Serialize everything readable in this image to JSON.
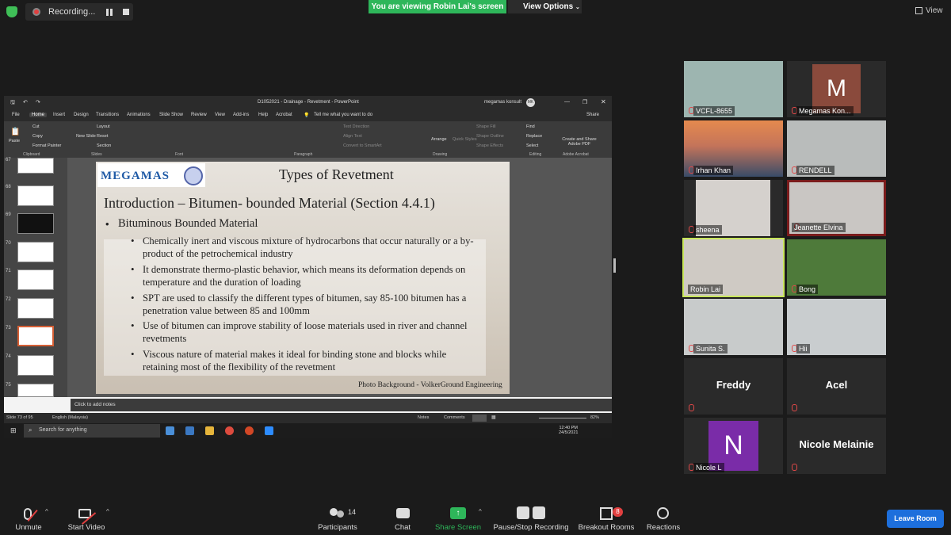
{
  "topbar": {
    "recording_label": "Recording...",
    "viewing_banner": "You are viewing Robin Lai's screen",
    "view_options": "View Options",
    "view_label": "View"
  },
  "ppt": {
    "window_title": "D1052021 - Drainage - Revetment - PowerPoint",
    "account": "megamas konsult",
    "account_initials": "MK",
    "share_label": "Share",
    "tabs": [
      "File",
      "Home",
      "Insert",
      "Design",
      "Transitions",
      "Animations",
      "Slide Show",
      "Review",
      "View",
      "Add-ins",
      "Help",
      "Acrobat"
    ],
    "tell_me": "Tell me what you want to do",
    "ribbon": {
      "paste": "Paste",
      "cut": "Cut",
      "copy": "Copy",
      "format_painter": "Format Painter",
      "new_slide": "New Slide",
      "layout": "Layout",
      "reset": "Reset",
      "section": "Section",
      "arrange": "Arrange",
      "quick_styles": "Quick Styles",
      "find": "Find",
      "replace": "Replace",
      "select": "Select",
      "create_pdf": "Create and Share Adobe PDF",
      "text_direction": "Text Direction",
      "align_text": "Align Text",
      "convert_smartart": "Convert to SmartArt",
      "shape_fill": "Shape Fill",
      "shape_outline": "Shape Outline",
      "shape_effects": "Shape Effects",
      "groups": [
        "Clipboard",
        "Slides",
        "Font",
        "Paragraph",
        "Drawing",
        "Editing",
        "Adobe Acrobat"
      ]
    },
    "thumbnails": [
      "67",
      "68",
      "69",
      "70",
      "71",
      "72",
      "73",
      "74",
      "75"
    ],
    "slide": {
      "logo": "MEGAMAS",
      "title": "Types of Revetment",
      "subtitle": "Introduction – Bitumen- bounded Material  (Section 4.4.1)",
      "bullet_main": "Bituminous Bounded Material",
      "bullets": [
        "Chemically inert and viscous mixture of hydrocarbons that occur naturally or a by-product of the petrochemical industry",
        "It demonstrate thermo-plastic behavior, which means its deformation depends on temperature and the duration of loading",
        "SPT are used to classify the different types of bitumen, say 85-100 bitumen has a penetration value between 85 and 100mm",
        "Use of bitumen can improve stability of loose materials used in river and channel revetments",
        "Viscous nature of material makes it ideal for binding stone and blocks while retaining most of the flexibility of the revetment"
      ],
      "credit": "Photo Background - VolkerGround Engineering"
    },
    "notes_placeholder": "Click to add notes",
    "status": {
      "slide_count": "Slide 73 of 95",
      "language": "English (Malaysia)",
      "notes": "Notes",
      "comments": "Comments",
      "zoom": "82%"
    },
    "taskbar": {
      "search": "Search for anything",
      "time": "12:40 PM",
      "date": "24/5/2021"
    }
  },
  "participants": [
    {
      "name": "VCFL-8655",
      "type": "video",
      "color": "#9db5b0"
    },
    {
      "name": "Megamas Kon...",
      "type": "avatar",
      "letter": "M"
    },
    {
      "name": "Irhan Khan",
      "type": "video",
      "color": "#c4745a"
    },
    {
      "name": "RENDELL",
      "type": "video",
      "color": "#b9bcbb"
    },
    {
      "name": "sheena",
      "type": "video",
      "color": "#d5d1cd"
    },
    {
      "name": "Jeanette Elvina",
      "type": "video",
      "color": "#c9c6c3"
    },
    {
      "name": "Robin Lai",
      "type": "video",
      "color": "#cfcac4"
    },
    {
      "name": "Bong",
      "type": "video",
      "color": "#4e7a3a"
    },
    {
      "name": "Sunita S.",
      "type": "video",
      "color": "#c8cbcb"
    },
    {
      "name": "Hii",
      "type": "video",
      "color": "#c9cdcf"
    },
    {
      "name": "Freddy",
      "type": "name"
    },
    {
      "name": "Acel",
      "type": "name"
    },
    {
      "name": "Nicole L",
      "type": "avatar",
      "letter": "N"
    },
    {
      "name": "Nicole Melainie",
      "type": "name"
    }
  ],
  "toolbar": {
    "unmute": "Unmute",
    "start_video": "Start Video",
    "participants": "Participants",
    "participants_count": "14",
    "chat": "Chat",
    "share_screen": "Share Screen",
    "pause_stop": "Pause/Stop Recording",
    "breakout": "Breakout Rooms",
    "breakout_badge": "8",
    "reactions": "Reactions",
    "leave": "Leave Room"
  },
  "colors": {
    "accent_green": "#2eb65a",
    "leave_blue": "#1d6fdc",
    "active_speaker": "#c8e65a"
  }
}
